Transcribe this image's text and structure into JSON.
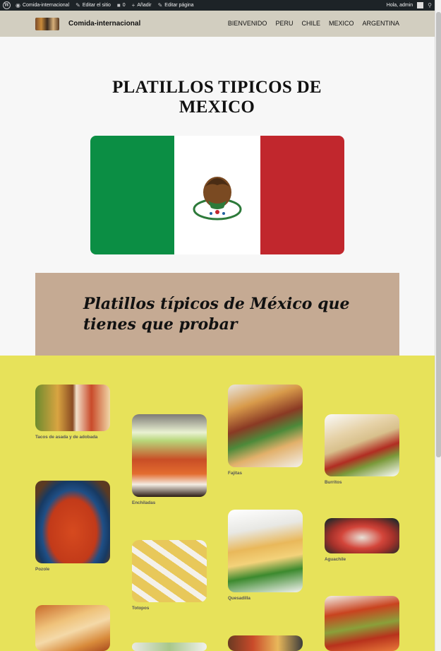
{
  "adminbar": {
    "site": "Comida-internacional",
    "edit_site": "Editar el sitio",
    "comments_count": "0",
    "add_new": "Añadir",
    "edit_page": "Editar página",
    "greeting": "Hola, admin"
  },
  "header": {
    "site_title": "Comida-internacional",
    "nav": [
      "BIENVENIDO",
      "PERU",
      "CHILE",
      "MEXICO",
      "ARGENTINA"
    ]
  },
  "hero": {
    "title": "PLATILLOS TIPICOS DE MEXICO"
  },
  "banner": {
    "heading": "Platillos típicos de México que tienes que probar"
  },
  "dishes": [
    {
      "name": "Tacos de asada y de adobada"
    },
    {
      "name": "Enchiladas"
    },
    {
      "name": "Fajitas"
    },
    {
      "name": "Burritos"
    },
    {
      "name": "Pozole"
    },
    {
      "name": "Totopos"
    },
    {
      "name": "Quesadilla"
    },
    {
      "name": "Aguachile"
    }
  ],
  "icons": {
    "wordpress": "wordpress-icon",
    "dashboard": "dashboard-icon",
    "edit": "pencil-icon",
    "comments": "comment-icon",
    "add": "plus-icon",
    "search": "search-icon",
    "coat_of_arms": "mexican-coat-of-arms-icon"
  },
  "colors": {
    "adminbar": "#1d2327",
    "header": "#d2cec0",
    "banner": "#c5aa93",
    "section": "#e7e25a",
    "flag_green": "#0b8e44",
    "flag_white": "#ffffff",
    "flag_red": "#c1272d"
  }
}
